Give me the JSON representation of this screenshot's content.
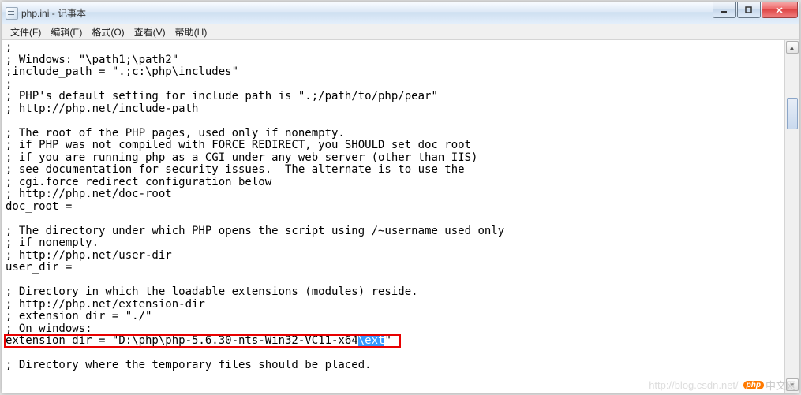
{
  "window": {
    "title": "php.ini - 记事本"
  },
  "menu": {
    "file": "文件(F)",
    "edit": "编辑(E)",
    "format": "格式(O)",
    "view": "查看(V)",
    "help": "帮助(H)"
  },
  "editor": {
    "lines": [
      ";",
      "; Windows: \"\\path1;\\path2\"",
      ";include_path = \".;c:\\php\\includes\"",
      ";",
      "; PHP's default setting for include_path is \".;/path/to/php/pear\"",
      "; http://php.net/include-path",
      "",
      "; The root of the PHP pages, used only if nonempty.",
      "; if PHP was not compiled with FORCE_REDIRECT, you SHOULD set doc_root",
      "; if you are running php as a CGI under any web server (other than IIS)",
      "; see documentation for security issues.  The alternate is to use the",
      "; cgi.force_redirect configuration below",
      "; http://php.net/doc-root",
      "doc_root =",
      "",
      "; The directory under which PHP opens the script using /~username used only",
      "; if nonempty.",
      "; http://php.net/user-dir",
      "user_dir =",
      "",
      "; Directory in which the loadable extensions (modules) reside.",
      "; http://php.net/extension-dir",
      "; extension_dir = \"./\"",
      "; On windows:"
    ],
    "highlighted": {
      "prefix": "extension_dir = \"D:\\php\\php-5.6.30-nts-Win32-VC11-x64",
      "selected": "\\ext",
      "suffix": "\""
    },
    "after": [
      "",
      "; Directory where the temporary files should be placed."
    ]
  },
  "watermark": {
    "url": "http://blog.csdn.net/",
    "php": "php",
    "cn": "中文网"
  }
}
